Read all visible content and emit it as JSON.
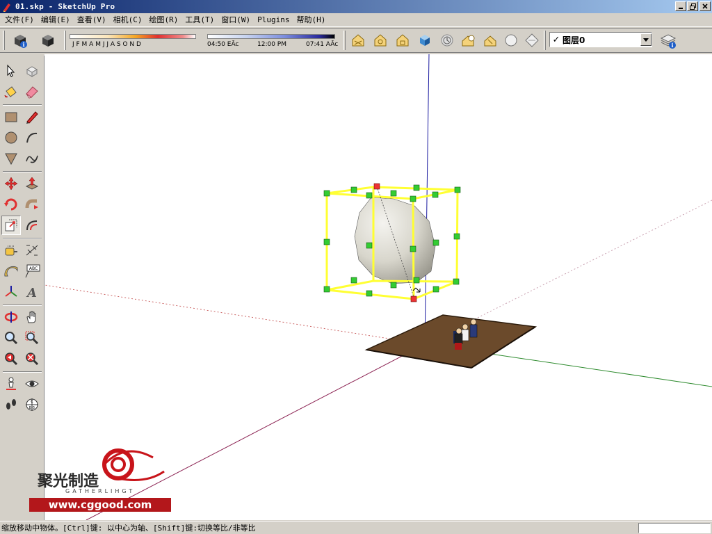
{
  "window": {
    "title": "01.skp - SketchUp Pro"
  },
  "menubar": {
    "items": [
      "文件(F)",
      "编辑(E)",
      "查看(V)",
      "相机(C)",
      "绘图(R)",
      "工具(T)",
      "窗口(W)",
      "Plugins",
      "帮助(H)"
    ]
  },
  "toolbar": {
    "months": "J F M A M J J A S O N D",
    "time_start": "04:50 EĀc",
    "time_mid": "12:00 PM",
    "time_end": "07:41 AĀc",
    "layer": {
      "checked": "✓",
      "name": "图层0"
    }
  },
  "status": {
    "text": "缩放移动中物体。[Ctrl]键: 以中心为轴、[Shift]键:切换等比/非等比"
  },
  "watermark": {
    "cn": "聚光制造",
    "en": "GATHERLIHGT",
    "url": "www.cggood.com"
  },
  "colors": {
    "selection_box": "#ffff33",
    "handle": "#33cc33",
    "handle_active": "#ee3333",
    "axis_blue": "#1a1aa0",
    "axis_red": "#8b2252",
    "axis_green": "#2e8b2e",
    "ground": "#6b4a2b",
    "accent_red": "#b3171b"
  }
}
